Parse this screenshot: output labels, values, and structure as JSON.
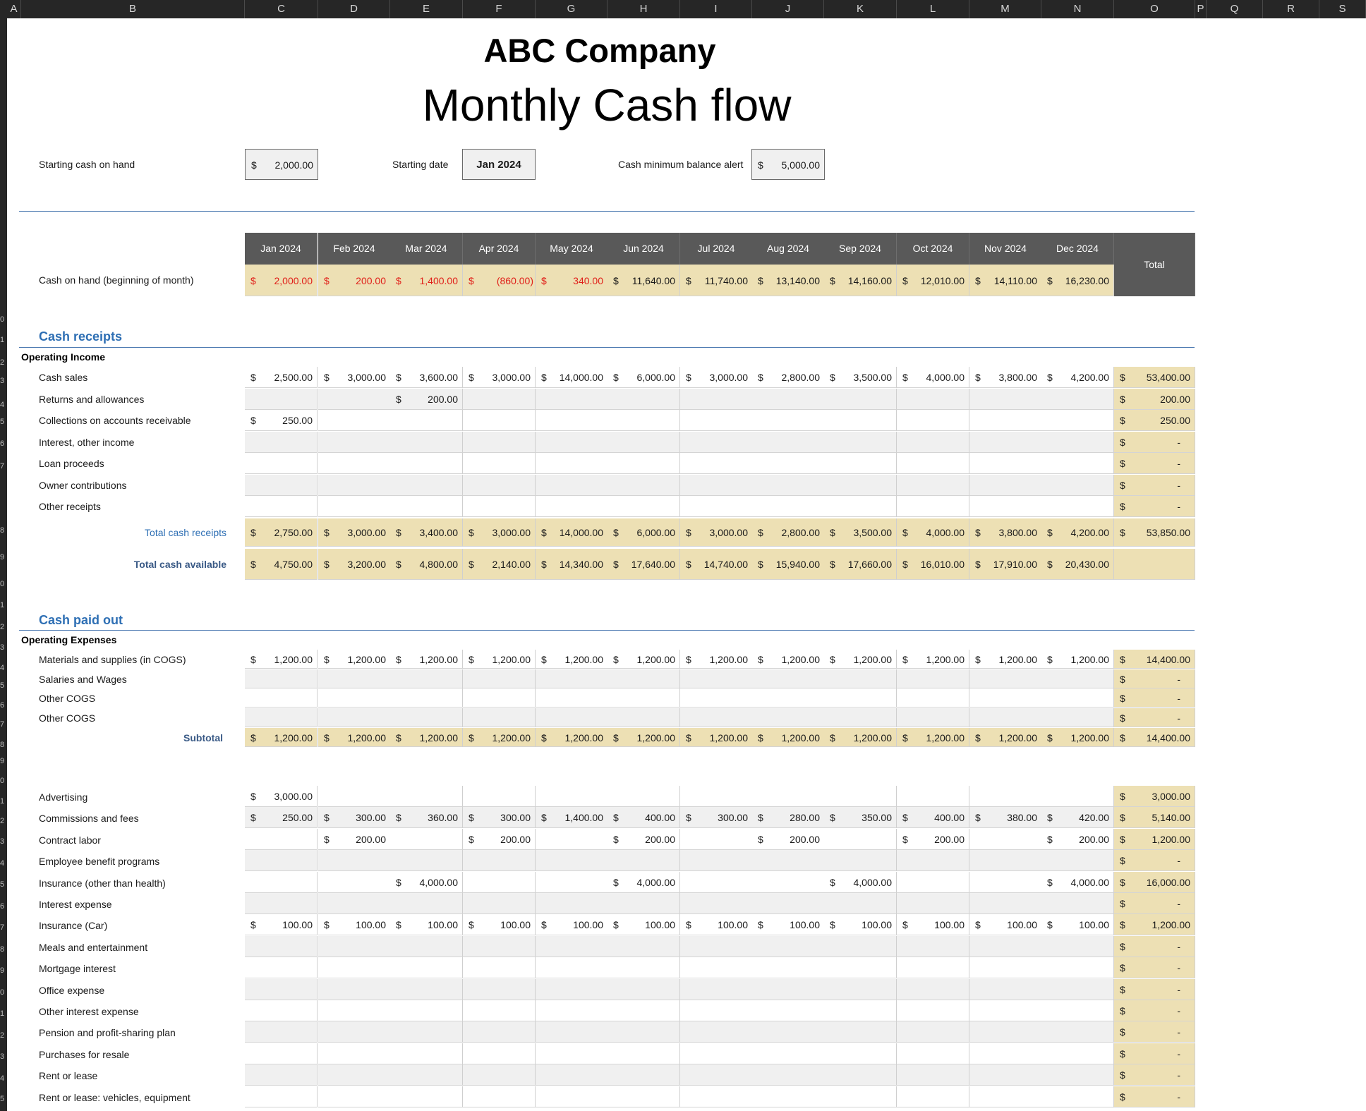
{
  "columns": [
    "A",
    "B",
    "C",
    "D",
    "E",
    "F",
    "G",
    "H",
    "I",
    "J",
    "K",
    "L",
    "M",
    "N",
    "O",
    "P",
    "Q",
    "R",
    "S"
  ],
  "company": "ABC Company",
  "title": "Monthly Cash flow",
  "inputs": {
    "starting_cash_label": "Starting cash on hand",
    "starting_cash": "2,000.00",
    "starting_date_label": "Starting date",
    "starting_date": "Jan 2024",
    "min_balance_label": "Cash minimum balance alert",
    "min_balance": "5,000.00",
    "currency": "$"
  },
  "months": [
    "Jan 2024",
    "Feb 2024",
    "Mar 2024",
    "Apr 2024",
    "May 2024",
    "Jun 2024",
    "Jul 2024",
    "Aug 2024",
    "Sep 2024",
    "Oct 2024",
    "Nov 2024",
    "Dec 2024"
  ],
  "total_label": "Total",
  "cash_on_hand": {
    "label": "Cash on hand (beginning of month)",
    "values": [
      "2,000.00",
      "200.00",
      "1,400.00",
      "(860.00)",
      "340.00",
      "11,640.00",
      "11,740.00",
      "13,140.00",
      "14,160.00",
      "12,010.00",
      "14,110.00",
      "16,230.00"
    ],
    "below_min": [
      true,
      true,
      true,
      true,
      true,
      false,
      false,
      false,
      false,
      false,
      false,
      false
    ]
  },
  "receipts": {
    "section": "Cash receipts",
    "group": "Operating Income",
    "rows": [
      {
        "label": "Cash sales",
        "values": [
          "2,500.00",
          "3,000.00",
          "3,600.00",
          "3,000.00",
          "14,000.00",
          "6,000.00",
          "3,000.00",
          "2,800.00",
          "3,500.00",
          "4,000.00",
          "3,800.00",
          "4,200.00"
        ],
        "total": "53,400.00"
      },
      {
        "label": "Returns and allowances",
        "values": [
          "",
          "",
          "200.00",
          "",
          "",
          "",
          "",
          "",
          "",
          "",
          "",
          ""
        ],
        "total": "200.00"
      },
      {
        "label": "Collections on accounts receivable",
        "values": [
          "250.00",
          "",
          "",
          "",
          "",
          "",
          "",
          "",
          "",
          "",
          "",
          ""
        ],
        "total": "250.00"
      },
      {
        "label": "Interest, other income",
        "values": [
          "",
          "",
          "",
          "",
          "",
          "",
          "",
          "",
          "",
          "",
          "",
          ""
        ],
        "total": "-"
      },
      {
        "label": "Loan proceeds",
        "values": [
          "",
          "",
          "",
          "",
          "",
          "",
          "",
          "",
          "",
          "",
          "",
          ""
        ],
        "total": "-"
      },
      {
        "label": "Owner contributions",
        "values": [
          "",
          "",
          "",
          "",
          "",
          "",
          "",
          "",
          "",
          "",
          "",
          ""
        ],
        "total": "-"
      },
      {
        "label": "Other receipts",
        "values": [
          "",
          "",
          "",
          "",
          "",
          "",
          "",
          "",
          "",
          "",
          "",
          ""
        ],
        "total": "-"
      }
    ],
    "total_row": {
      "label": "Total cash receipts",
      "values": [
        "2,750.00",
        "3,000.00",
        "3,400.00",
        "3,000.00",
        "14,000.00",
        "6,000.00",
        "3,000.00",
        "2,800.00",
        "3,500.00",
        "4,000.00",
        "3,800.00",
        "4,200.00"
      ],
      "total": "53,850.00"
    },
    "available_row": {
      "label": "Total cash available",
      "values": [
        "4,750.00",
        "3,200.00",
        "4,800.00",
        "2,140.00",
        "14,340.00",
        "17,640.00",
        "14,740.00",
        "15,940.00",
        "17,660.00",
        "16,010.00",
        "17,910.00",
        "20,430.00"
      ],
      "total": ""
    }
  },
  "paid_out": {
    "section": "Cash paid out",
    "group": "Operating Expenses",
    "cogs_rows": [
      {
        "label": "Materials and supplies (in COGS)",
        "values": [
          "1,200.00",
          "1,200.00",
          "1,200.00",
          "1,200.00",
          "1,200.00",
          "1,200.00",
          "1,200.00",
          "1,200.00",
          "1,200.00",
          "1,200.00",
          "1,200.00",
          "1,200.00"
        ],
        "total": "14,400.00"
      },
      {
        "label": "Salaries and Wages",
        "values": [
          "",
          "",
          "",
          "",
          "",
          "",
          "",
          "",
          "",
          "",
          "",
          ""
        ],
        "total": "-"
      },
      {
        "label": "Other COGS",
        "values": [
          "",
          "",
          "",
          "",
          "",
          "",
          "",
          "",
          "",
          "",
          "",
          ""
        ],
        "total": "-"
      },
      {
        "label": "Other COGS",
        "values": [
          "",
          "",
          "",
          "",
          "",
          "",
          "",
          "",
          "",
          "",
          "",
          ""
        ],
        "total": "-"
      }
    ],
    "subtotal_row": {
      "label": "Subtotal",
      "values": [
        "1,200.00",
        "1,200.00",
        "1,200.00",
        "1,200.00",
        "1,200.00",
        "1,200.00",
        "1,200.00",
        "1,200.00",
        "1,200.00",
        "1,200.00",
        "1,200.00",
        "1,200.00"
      ],
      "total": "14,400.00"
    },
    "expense_rows": [
      {
        "label": "Advertising",
        "values": [
          "3,000.00",
          "",
          "",
          "",
          "",
          "",
          "",
          "",
          "",
          "",
          "",
          ""
        ],
        "total": "3,000.00"
      },
      {
        "label": "Commissions and fees",
        "values": [
          "250.00",
          "300.00",
          "360.00",
          "300.00",
          "1,400.00",
          "400.00",
          "300.00",
          "280.00",
          "350.00",
          "400.00",
          "380.00",
          "420.00"
        ],
        "total": "5,140.00"
      },
      {
        "label": "Contract labor",
        "values": [
          "",
          "200.00",
          "",
          "200.00",
          "",
          "200.00",
          "",
          "200.00",
          "",
          "200.00",
          "",
          "200.00"
        ],
        "total": "1,200.00"
      },
      {
        "label": "Employee benefit programs",
        "values": [
          "",
          "",
          "",
          "",
          "",
          "",
          "",
          "",
          "",
          "",
          "",
          ""
        ],
        "total": "-"
      },
      {
        "label": "Insurance (other than health)",
        "values": [
          "",
          "",
          "4,000.00",
          "",
          "",
          "4,000.00",
          "",
          "",
          "4,000.00",
          "",
          "",
          "4,000.00"
        ],
        "total": "16,000.00"
      },
      {
        "label": "Interest expense",
        "values": [
          "",
          "",
          "",
          "",
          "",
          "",
          "",
          "",
          "",
          "",
          "",
          ""
        ],
        "total": "-"
      },
      {
        "label": "Insurance (Car)",
        "values": [
          "100.00",
          "100.00",
          "100.00",
          "100.00",
          "100.00",
          "100.00",
          "100.00",
          "100.00",
          "100.00",
          "100.00",
          "100.00",
          "100.00"
        ],
        "total": "1,200.00"
      },
      {
        "label": "Meals and entertainment",
        "values": [
          "",
          "",
          "",
          "",
          "",
          "",
          "",
          "",
          "",
          "",
          "",
          ""
        ],
        "total": "-"
      },
      {
        "label": "Mortgage interest",
        "values": [
          "",
          "",
          "",
          "",
          "",
          "",
          "",
          "",
          "",
          "",
          "",
          ""
        ],
        "total": "-"
      },
      {
        "label": "Office expense",
        "values": [
          "",
          "",
          "",
          "",
          "",
          "",
          "",
          "",
          "",
          "",
          "",
          ""
        ],
        "total": "-"
      },
      {
        "label": "Other interest expense",
        "values": [
          "",
          "",
          "",
          "",
          "",
          "",
          "",
          "",
          "",
          "",
          "",
          ""
        ],
        "total": "-"
      },
      {
        "label": "Pension and profit-sharing plan",
        "values": [
          "",
          "",
          "",
          "",
          "",
          "",
          "",
          "",
          "",
          "",
          "",
          ""
        ],
        "total": "-"
      },
      {
        "label": "Purchases for resale",
        "values": [
          "",
          "",
          "",
          "",
          "",
          "",
          "",
          "",
          "",
          "",
          "",
          ""
        ],
        "total": "-"
      },
      {
        "label": "Rent or lease",
        "values": [
          "",
          "",
          "",
          "",
          "",
          "",
          "",
          "",
          "",
          "",
          "",
          ""
        ],
        "total": "-"
      },
      {
        "label": "Rent or lease: vehicles, equipment",
        "values": [
          "",
          "",
          "",
          "",
          "",
          "",
          "",
          "",
          "",
          "",
          "",
          ""
        ],
        "total": "-"
      }
    ]
  },
  "colors": {
    "header_bg": "#595959",
    "highlight": "#ede0b4",
    "zebra": "#f0f0f0",
    "accent": "#2e6fb4",
    "negative": "#e0201a"
  }
}
